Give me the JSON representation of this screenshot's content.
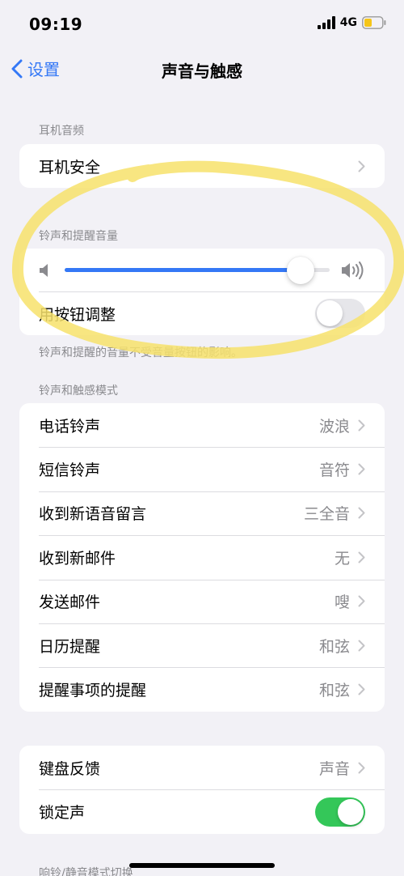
{
  "status_bar": {
    "time": "09:19",
    "network": "4G",
    "battery_color": "#f5c518"
  },
  "nav": {
    "back_label": "设置",
    "title": "声音与触感"
  },
  "accent_color": "#3478f6",
  "headphone_section": {
    "header": "耳机音频",
    "items": [
      {
        "label": "耳机安全"
      }
    ]
  },
  "ringer_section": {
    "header": "铃声和提醒音量",
    "volume_level": 0.89,
    "toggle_label": "用按钮调整",
    "toggle_on": false,
    "footer": "铃声和提醒的音量不受音量按钮的影响。"
  },
  "patterns_section": {
    "header": "铃声和触感模式",
    "items": [
      {
        "label": "电话铃声",
        "value": "波浪"
      },
      {
        "label": "短信铃声",
        "value": "音符"
      },
      {
        "label": "收到新语音留言",
        "value": "三全音"
      },
      {
        "label": "收到新邮件",
        "value": "无"
      },
      {
        "label": "发送邮件",
        "value": "嗖"
      },
      {
        "label": "日历提醒",
        "value": "和弦"
      },
      {
        "label": "提醒事项的提醒",
        "value": "和弦"
      }
    ]
  },
  "system_section": {
    "keyboard_label": "键盘反馈",
    "keyboard_value": "声音",
    "lock_label": "锁定声",
    "lock_on": true
  },
  "next_section": {
    "header": "响铃/静音模式切换"
  },
  "highlight_color": "#f7e26b"
}
